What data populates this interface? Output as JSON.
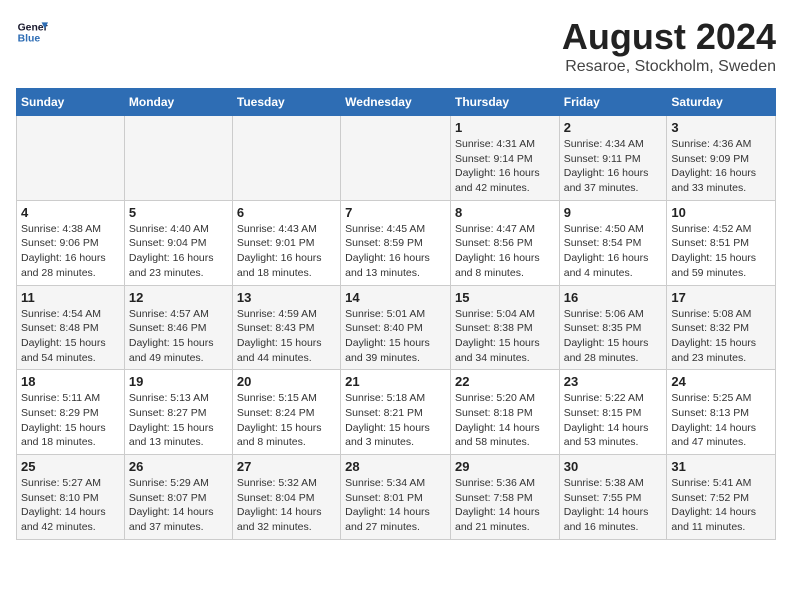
{
  "header": {
    "logo_line1": "General",
    "logo_line2": "Blue",
    "month_title": "August 2024",
    "location": "Resaroe, Stockholm, Sweden"
  },
  "days_of_week": [
    "Sunday",
    "Monday",
    "Tuesday",
    "Wednesday",
    "Thursday",
    "Friday",
    "Saturday"
  ],
  "weeks": [
    [
      {
        "day": "",
        "info": ""
      },
      {
        "day": "",
        "info": ""
      },
      {
        "day": "",
        "info": ""
      },
      {
        "day": "",
        "info": ""
      },
      {
        "day": "1",
        "info": "Sunrise: 4:31 AM\nSunset: 9:14 PM\nDaylight: 16 hours\nand 42 minutes."
      },
      {
        "day": "2",
        "info": "Sunrise: 4:34 AM\nSunset: 9:11 PM\nDaylight: 16 hours\nand 37 minutes."
      },
      {
        "day": "3",
        "info": "Sunrise: 4:36 AM\nSunset: 9:09 PM\nDaylight: 16 hours\nand 33 minutes."
      }
    ],
    [
      {
        "day": "4",
        "info": "Sunrise: 4:38 AM\nSunset: 9:06 PM\nDaylight: 16 hours\nand 28 minutes."
      },
      {
        "day": "5",
        "info": "Sunrise: 4:40 AM\nSunset: 9:04 PM\nDaylight: 16 hours\nand 23 minutes."
      },
      {
        "day": "6",
        "info": "Sunrise: 4:43 AM\nSunset: 9:01 PM\nDaylight: 16 hours\nand 18 minutes."
      },
      {
        "day": "7",
        "info": "Sunrise: 4:45 AM\nSunset: 8:59 PM\nDaylight: 16 hours\nand 13 minutes."
      },
      {
        "day": "8",
        "info": "Sunrise: 4:47 AM\nSunset: 8:56 PM\nDaylight: 16 hours\nand 8 minutes."
      },
      {
        "day": "9",
        "info": "Sunrise: 4:50 AM\nSunset: 8:54 PM\nDaylight: 16 hours\nand 4 minutes."
      },
      {
        "day": "10",
        "info": "Sunrise: 4:52 AM\nSunset: 8:51 PM\nDaylight: 15 hours\nand 59 minutes."
      }
    ],
    [
      {
        "day": "11",
        "info": "Sunrise: 4:54 AM\nSunset: 8:48 PM\nDaylight: 15 hours\nand 54 minutes."
      },
      {
        "day": "12",
        "info": "Sunrise: 4:57 AM\nSunset: 8:46 PM\nDaylight: 15 hours\nand 49 minutes."
      },
      {
        "day": "13",
        "info": "Sunrise: 4:59 AM\nSunset: 8:43 PM\nDaylight: 15 hours\nand 44 minutes."
      },
      {
        "day": "14",
        "info": "Sunrise: 5:01 AM\nSunset: 8:40 PM\nDaylight: 15 hours\nand 39 minutes."
      },
      {
        "day": "15",
        "info": "Sunrise: 5:04 AM\nSunset: 8:38 PM\nDaylight: 15 hours\nand 34 minutes."
      },
      {
        "day": "16",
        "info": "Sunrise: 5:06 AM\nSunset: 8:35 PM\nDaylight: 15 hours\nand 28 minutes."
      },
      {
        "day": "17",
        "info": "Sunrise: 5:08 AM\nSunset: 8:32 PM\nDaylight: 15 hours\nand 23 minutes."
      }
    ],
    [
      {
        "day": "18",
        "info": "Sunrise: 5:11 AM\nSunset: 8:29 PM\nDaylight: 15 hours\nand 18 minutes."
      },
      {
        "day": "19",
        "info": "Sunrise: 5:13 AM\nSunset: 8:27 PM\nDaylight: 15 hours\nand 13 minutes."
      },
      {
        "day": "20",
        "info": "Sunrise: 5:15 AM\nSunset: 8:24 PM\nDaylight: 15 hours\nand 8 minutes."
      },
      {
        "day": "21",
        "info": "Sunrise: 5:18 AM\nSunset: 8:21 PM\nDaylight: 15 hours\nand 3 minutes."
      },
      {
        "day": "22",
        "info": "Sunrise: 5:20 AM\nSunset: 8:18 PM\nDaylight: 14 hours\nand 58 minutes."
      },
      {
        "day": "23",
        "info": "Sunrise: 5:22 AM\nSunset: 8:15 PM\nDaylight: 14 hours\nand 53 minutes."
      },
      {
        "day": "24",
        "info": "Sunrise: 5:25 AM\nSunset: 8:13 PM\nDaylight: 14 hours\nand 47 minutes."
      }
    ],
    [
      {
        "day": "25",
        "info": "Sunrise: 5:27 AM\nSunset: 8:10 PM\nDaylight: 14 hours\nand 42 minutes."
      },
      {
        "day": "26",
        "info": "Sunrise: 5:29 AM\nSunset: 8:07 PM\nDaylight: 14 hours\nand 37 minutes."
      },
      {
        "day": "27",
        "info": "Sunrise: 5:32 AM\nSunset: 8:04 PM\nDaylight: 14 hours\nand 32 minutes."
      },
      {
        "day": "28",
        "info": "Sunrise: 5:34 AM\nSunset: 8:01 PM\nDaylight: 14 hours\nand 27 minutes."
      },
      {
        "day": "29",
        "info": "Sunrise: 5:36 AM\nSunset: 7:58 PM\nDaylight: 14 hours\nand 21 minutes."
      },
      {
        "day": "30",
        "info": "Sunrise: 5:38 AM\nSunset: 7:55 PM\nDaylight: 14 hours\nand 16 minutes."
      },
      {
        "day": "31",
        "info": "Sunrise: 5:41 AM\nSunset: 7:52 PM\nDaylight: 14 hours\nand 11 minutes."
      }
    ]
  ]
}
